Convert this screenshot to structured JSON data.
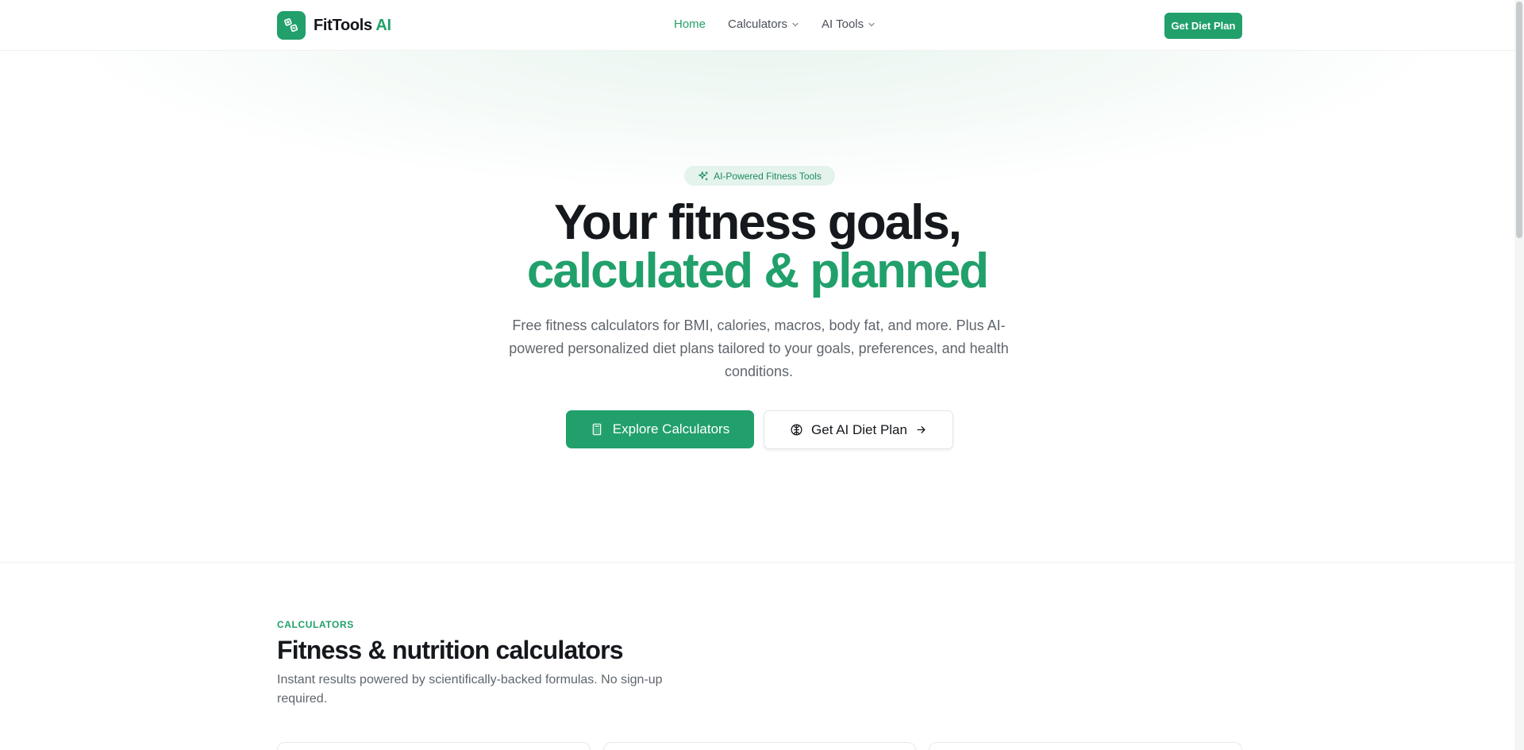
{
  "header": {
    "brand_name": "FitTools",
    "brand_accent": "AI",
    "nav": [
      {
        "label": "Home",
        "active": true
      },
      {
        "label": "Calculators",
        "has_dropdown": true
      },
      {
        "label": "AI Tools",
        "has_dropdown": true
      }
    ],
    "cta_label": "Get Diet Plan"
  },
  "hero": {
    "badge": "AI-Powered Fitness Tools",
    "title_line1": "Your fitness goals,",
    "title_line2": "calculated & planned",
    "subtitle": "Free fitness calculators for BMI, calories, macros, body fat, and more. Plus AI-powered personalized diet plans tailored to your goals, preferences, and health conditions.",
    "primary_button": "Explore Calculators",
    "secondary_button": "Get AI Diet Plan"
  },
  "calculators_section": {
    "eyebrow": "CALCULATORS",
    "title": "Fitness & nutrition calculators",
    "subtitle": "Instant results powered by scientifically-backed formulas. No sign-up required."
  },
  "icons": {
    "brand": "calculator-logo-icon",
    "badge": "sparkles-icon",
    "primary_button": "calculator-icon",
    "secondary_button": "brain-icon",
    "secondary_button_trailing": "arrow-right-icon",
    "nav_dropdown": "chevron-down-icon"
  },
  "colors": {
    "brand_green": "#21a06b",
    "text_dark": "#15181c",
    "text_muted": "#5f666d",
    "badge_bg": "#e4f3ec"
  }
}
